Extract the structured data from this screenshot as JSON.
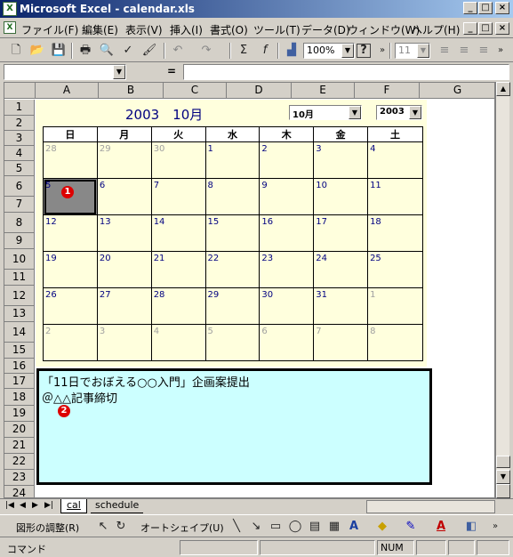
{
  "window": {
    "title": "Microsoft Excel - calendar.xls",
    "app_icon": "X"
  },
  "menu": [
    "ファイル(F)",
    "編集(E)",
    "表示(V)",
    "挿入(I)",
    "書式(O)",
    "ツール(T)",
    "データ(D)",
    "ウィンドウ(W)",
    "ヘルプ(H)"
  ],
  "toolbar": {
    "zoom": "100%",
    "font_size": "11"
  },
  "formula": {
    "name_box": "",
    "equals": "=",
    "content": ""
  },
  "columns": [
    "A",
    "B",
    "C",
    "D",
    "E",
    "F",
    "G"
  ],
  "rows": [
    "1",
    "2",
    "3",
    "4",
    "5",
    "6",
    "7",
    "8",
    "9",
    "10",
    "11",
    "12",
    "13",
    "14",
    "15",
    "16",
    "17",
    "18",
    "19",
    "20",
    "21",
    "22",
    "23",
    "24",
    "25"
  ],
  "calendar": {
    "title": "2003　10月",
    "month_select": "10月",
    "year_select": "2003",
    "weekdays": [
      "日",
      "月",
      "火",
      "水",
      "木",
      "金",
      "土"
    ],
    "weeks": [
      [
        "28",
        "29",
        "30",
        "1",
        "2",
        "3",
        "4"
      ],
      [
        "5",
        "6",
        "7",
        "8",
        "9",
        "10",
        "11"
      ],
      [
        "12",
        "13",
        "14",
        "15",
        "16",
        "17",
        "18"
      ],
      [
        "19",
        "20",
        "21",
        "22",
        "23",
        "24",
        "25"
      ],
      [
        "26",
        "27",
        "28",
        "29",
        "30",
        "31",
        "1"
      ],
      [
        "2",
        "3",
        "4",
        "5",
        "6",
        "7",
        "8"
      ]
    ]
  },
  "notes": {
    "line1": "「11日でおぼえる○○入門」企画案提出",
    "line2": "＠△△記事締切"
  },
  "badges": {
    "one": "1",
    "two": "2"
  },
  "sheets": {
    "active": "cal",
    "other": "schedule"
  },
  "drawing": {
    "adjust": "図形の調整(R)",
    "autoshape": "オートシェイプ(U)"
  },
  "status": {
    "mode": "コマンド",
    "num": "NUM"
  },
  "window_buttons": {
    "min": "_",
    "max": "□",
    "close": "×"
  }
}
